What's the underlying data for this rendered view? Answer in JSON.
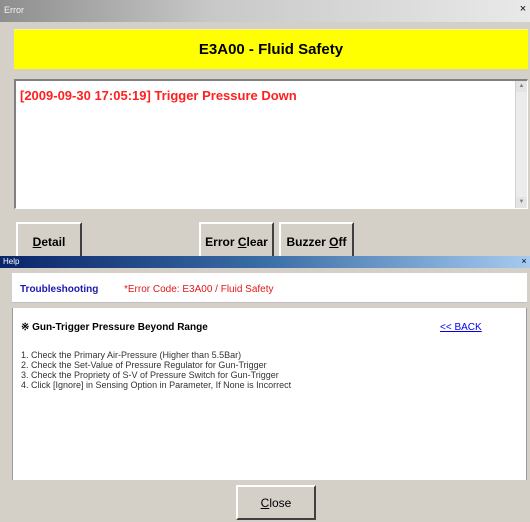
{
  "error_window": {
    "title": "Error",
    "close_glyph": "×",
    "banner_text": "E3A00 - Fluid Safety",
    "banner_color": "#ffff00",
    "message": "[2009-09-30 17:05:19] Trigger Pressure Down",
    "message_color": "#ff2020",
    "scroll_up": "▲",
    "scroll_down": "▼",
    "buttons": {
      "detail": {
        "pre": "",
        "key": "D",
        "post": "etail"
      },
      "error_clear": {
        "pre": "Error ",
        "key": "C",
        "post": "lear"
      },
      "buzzer_off": {
        "pre": "Buzzer ",
        "key": "O",
        "post": "ff"
      }
    }
  },
  "help_window": {
    "title": "Help",
    "close_glyph": "×",
    "troubleshooting_label": "Troubleshooting",
    "error_code_text": "*Error Code: E3A00 / Fluid Safety",
    "heading": "※ Gun-Trigger Pressure Beyond Range",
    "back_link": "<< BACK",
    "steps": [
      "1. Check the Primary Air-Pressure (Higher than 5.5Bar)",
      "2. Check the Set-Value of Pressure Regulator for Gun-Trigger",
      "3. Check the Propriety of S-V of Pressure Switch for Gun-Trigger",
      "4. Click [Ignore] in Sensing Option in Parameter, If None is Incorrect"
    ],
    "close_button": {
      "pre": "",
      "key": "C",
      "post": "lose"
    }
  }
}
